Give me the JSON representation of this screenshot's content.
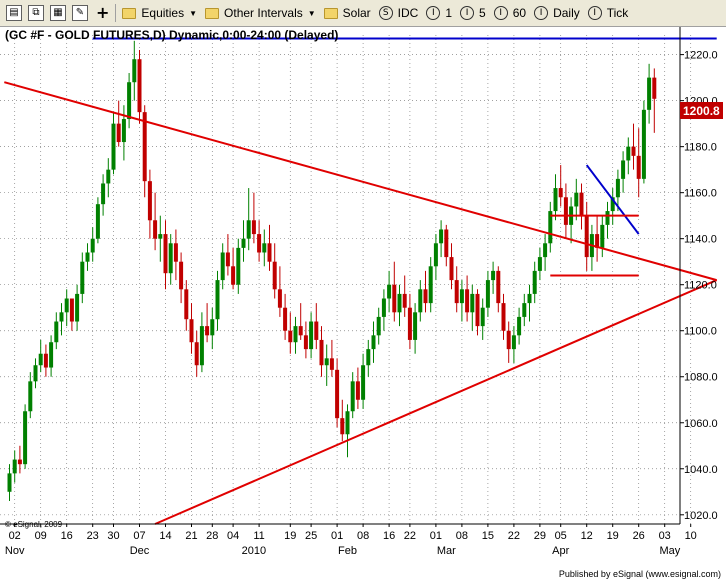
{
  "toolbar": {
    "icons": [
      "chart-icon",
      "copy-icon",
      "layout-icon",
      "edit-icon",
      "plus-icon"
    ],
    "equities_label": "Equities",
    "intervals_label": "Other Intervals",
    "solar_label": "Solar",
    "idc_label": "IDC",
    "interval_1": "1",
    "interval_5": "5",
    "interval_60": "60",
    "daily_label": "Daily",
    "tick_label": "Tick"
  },
  "chart": {
    "title": "(GC #F - GOLD FUTURES,D) Dynamic,0:00-24:00 (Delayed)",
    "copyright": "© eSignal, 2009",
    "published": "Published by eSignal (www.esignal.com)",
    "last_price": "1200.8"
  },
  "chart_data": {
    "type": "candlestick",
    "title": "(GC #F - GOLD FUTURES,D) Dynamic,0:00-24:00 (Delayed)",
    "ylim": [
      1016,
      1232
    ],
    "yticks": [
      1020.0,
      1040.0,
      1060.0,
      1080.0,
      1100.0,
      1120.0,
      1140.0,
      1160.0,
      1180.0,
      1200.0,
      1220.0
    ],
    "xticks": [
      {
        "label": "02",
        "i": 1
      },
      {
        "label": "09",
        "i": 6
      },
      {
        "label": "16",
        "i": 11
      },
      {
        "label": "23",
        "i": 16
      },
      {
        "label": "30",
        "i": 20
      },
      {
        "label": "07",
        "i": 25
      },
      {
        "label": "14",
        "i": 30
      },
      {
        "label": "21",
        "i": 35
      },
      {
        "label": "28",
        "i": 39
      },
      {
        "label": "04",
        "i": 43
      },
      {
        "label": "11",
        "i": 48
      },
      {
        "label": "19",
        "i": 54
      },
      {
        "label": "25",
        "i": 58
      },
      {
        "label": "01",
        "i": 63
      },
      {
        "label": "08",
        "i": 68
      },
      {
        "label": "16",
        "i": 73
      },
      {
        "label": "22",
        "i": 77
      },
      {
        "label": "01",
        "i": 82
      },
      {
        "label": "08",
        "i": 87
      },
      {
        "label": "15",
        "i": 92
      },
      {
        "label": "22",
        "i": 97
      },
      {
        "label": "29",
        "i": 102
      },
      {
        "label": "05",
        "i": 106
      },
      {
        "label": "12",
        "i": 111
      },
      {
        "label": "19",
        "i": 116
      },
      {
        "label": "26",
        "i": 121
      },
      {
        "label": "03",
        "i": 126
      },
      {
        "label": "10",
        "i": 131
      }
    ],
    "months": [
      {
        "label": "Nov",
        "i": 1
      },
      {
        "label": "Dec",
        "i": 25
      },
      {
        "label": "2010",
        "i": 47
      },
      {
        "label": "Feb",
        "i": 65
      },
      {
        "label": "Mar",
        "i": 84
      },
      {
        "label": "Apr",
        "i": 106
      },
      {
        "label": "May",
        "i": 127
      }
    ],
    "candles": [
      [
        1030,
        1042,
        1026,
        1038
      ],
      [
        1038,
        1048,
        1034,
        1044
      ],
      [
        1044,
        1050,
        1038,
        1042
      ],
      [
        1042,
        1068,
        1040,
        1065
      ],
      [
        1065,
        1082,
        1062,
        1078
      ],
      [
        1078,
        1088,
        1075,
        1085
      ],
      [
        1085,
        1096,
        1082,
        1090
      ],
      [
        1090,
        1094,
        1080,
        1084
      ],
      [
        1084,
        1098,
        1080,
        1095
      ],
      [
        1095,
        1108,
        1092,
        1104
      ],
      [
        1104,
        1112,
        1098,
        1108
      ],
      [
        1108,
        1118,
        1102,
        1114
      ],
      [
        1114,
        1110,
        1100,
        1104
      ],
      [
        1104,
        1120,
        1100,
        1116
      ],
      [
        1116,
        1134,
        1112,
        1130
      ],
      [
        1130,
        1138,
        1126,
        1134
      ],
      [
        1134,
        1145,
        1130,
        1140
      ],
      [
        1140,
        1158,
        1138,
        1155
      ],
      [
        1155,
        1168,
        1150,
        1164
      ],
      [
        1164,
        1175,
        1158,
        1170
      ],
      [
        1170,
        1195,
        1168,
        1190
      ],
      [
        1190,
        1200,
        1180,
        1182
      ],
      [
        1182,
        1198,
        1174,
        1192
      ],
      [
        1192,
        1212,
        1188,
        1208
      ],
      [
        1208,
        1226,
        1200,
        1218
      ],
      [
        1218,
        1222,
        1190,
        1195
      ],
      [
        1195,
        1198,
        1158,
        1165
      ],
      [
        1165,
        1170,
        1140,
        1148
      ],
      [
        1148,
        1160,
        1135,
        1140
      ],
      [
        1140,
        1150,
        1130,
        1142
      ],
      [
        1142,
        1148,
        1118,
        1125
      ],
      [
        1125,
        1142,
        1120,
        1138
      ],
      [
        1138,
        1144,
        1122,
        1130
      ],
      [
        1130,
        1134,
        1112,
        1118
      ],
      [
        1118,
        1122,
        1100,
        1105
      ],
      [
        1105,
        1112,
        1090,
        1095
      ],
      [
        1095,
        1100,
        1080,
        1085
      ],
      [
        1085,
        1108,
        1082,
        1102
      ],
      [
        1102,
        1112,
        1095,
        1098
      ],
      [
        1098,
        1110,
        1092,
        1105
      ],
      [
        1105,
        1126,
        1100,
        1122
      ],
      [
        1122,
        1138,
        1118,
        1134
      ],
      [
        1134,
        1142,
        1124,
        1128
      ],
      [
        1128,
        1136,
        1118,
        1120
      ],
      [
        1120,
        1140,
        1116,
        1136
      ],
      [
        1136,
        1148,
        1130,
        1140
      ],
      [
        1140,
        1162,
        1135,
        1148
      ],
      [
        1148,
        1160,
        1138,
        1142
      ],
      [
        1142,
        1148,
        1130,
        1134
      ],
      [
        1134,
        1144,
        1128,
        1138
      ],
      [
        1138,
        1146,
        1126,
        1130
      ],
      [
        1130,
        1138,
        1114,
        1118
      ],
      [
        1118,
        1128,
        1106,
        1110
      ],
      [
        1110,
        1116,
        1096,
        1100
      ],
      [
        1100,
        1108,
        1090,
        1095
      ],
      [
        1095,
        1106,
        1090,
        1102
      ],
      [
        1102,
        1112,
        1096,
        1098
      ],
      [
        1098,
        1104,
        1088,
        1092
      ],
      [
        1092,
        1108,
        1088,
        1104
      ],
      [
        1104,
        1112,
        1092,
        1096
      ],
      [
        1096,
        1102,
        1080,
        1085
      ],
      [
        1085,
        1094,
        1076,
        1088
      ],
      [
        1088,
        1096,
        1080,
        1083
      ],
      [
        1083,
        1088,
        1058,
        1062
      ],
      [
        1062,
        1070,
        1052,
        1055
      ],
      [
        1055,
        1068,
        1045,
        1065
      ],
      [
        1065,
        1082,
        1062,
        1078
      ],
      [
        1078,
        1084,
        1066,
        1070
      ],
      [
        1070,
        1090,
        1066,
        1085
      ],
      [
        1085,
        1096,
        1080,
        1092
      ],
      [
        1092,
        1104,
        1086,
        1098
      ],
      [
        1098,
        1110,
        1094,
        1106
      ],
      [
        1106,
        1118,
        1100,
        1114
      ],
      [
        1114,
        1126,
        1108,
        1120
      ],
      [
        1120,
        1130,
        1104,
        1108
      ],
      [
        1108,
        1120,
        1102,
        1116
      ],
      [
        1116,
        1124,
        1106,
        1110
      ],
      [
        1110,
        1116,
        1092,
        1096
      ],
      [
        1096,
        1112,
        1090,
        1108
      ],
      [
        1108,
        1122,
        1104,
        1118
      ],
      [
        1118,
        1126,
        1108,
        1112
      ],
      [
        1112,
        1132,
        1108,
        1128
      ],
      [
        1128,
        1142,
        1122,
        1138
      ],
      [
        1138,
        1148,
        1132,
        1144
      ],
      [
        1144,
        1146,
        1128,
        1132
      ],
      [
        1132,
        1138,
        1118,
        1122
      ],
      [
        1122,
        1128,
        1108,
        1112
      ],
      [
        1112,
        1122,
        1104,
        1118
      ],
      [
        1118,
        1124,
        1104,
        1108
      ],
      [
        1108,
        1120,
        1100,
        1116
      ],
      [
        1116,
        1118,
        1098,
        1102
      ],
      [
        1102,
        1114,
        1096,
        1110
      ],
      [
        1110,
        1126,
        1106,
        1122
      ],
      [
        1122,
        1130,
        1116,
        1126
      ],
      [
        1126,
        1128,
        1108,
        1112
      ],
      [
        1112,
        1116,
        1096,
        1100
      ],
      [
        1100,
        1104,
        1086,
        1092
      ],
      [
        1092,
        1102,
        1086,
        1098
      ],
      [
        1098,
        1110,
        1094,
        1106
      ],
      [
        1106,
        1116,
        1102,
        1112
      ],
      [
        1112,
        1120,
        1104,
        1116
      ],
      [
        1116,
        1130,
        1112,
        1126
      ],
      [
        1126,
        1136,
        1122,
        1132
      ],
      [
        1132,
        1142,
        1126,
        1138
      ],
      [
        1138,
        1156,
        1134,
        1152
      ],
      [
        1152,
        1168,
        1148,
        1162
      ],
      [
        1162,
        1172,
        1154,
        1158
      ],
      [
        1158,
        1164,
        1140,
        1146
      ],
      [
        1146,
        1158,
        1138,
        1154
      ],
      [
        1154,
        1166,
        1148,
        1160
      ],
      [
        1160,
        1164,
        1144,
        1150
      ],
      [
        1150,
        1156,
        1126,
        1132
      ],
      [
        1132,
        1146,
        1126,
        1142
      ],
      [
        1142,
        1150,
        1130,
        1136
      ],
      [
        1136,
        1150,
        1132,
        1146
      ],
      [
        1146,
        1156,
        1140,
        1152
      ],
      [
        1152,
        1162,
        1146,
        1158
      ],
      [
        1158,
        1170,
        1152,
        1166
      ],
      [
        1166,
        1178,
        1160,
        1174
      ],
      [
        1174,
        1184,
        1168,
        1180
      ],
      [
        1180,
        1190,
        1170,
        1176
      ],
      [
        1176,
        1188,
        1158,
        1166
      ],
      [
        1166,
        1200,
        1164,
        1196
      ],
      [
        1196,
        1216,
        1190,
        1210
      ],
      [
        1210,
        1214,
        1186,
        1200.8
      ]
    ],
    "trendlines": [
      {
        "color": "#e00000",
        "from": [
          -1,
          1208
        ],
        "to": [
          136,
          1122
        ]
      },
      {
        "color": "#e00000",
        "from": [
          28,
          1016
        ],
        "to": [
          136,
          1122
        ]
      },
      {
        "color": "#0000cc",
        "from": [
          16,
          1227
        ],
        "to": [
          136,
          1227
        ]
      },
      {
        "color": "#0000cc",
        "from": [
          111,
          1172
        ],
        "to": [
          121,
          1142
        ]
      },
      {
        "color": "#e00000",
        "from": [
          104,
          1150
        ],
        "to": [
          121,
          1150
        ]
      },
      {
        "color": "#e00000",
        "from": [
          104,
          1124
        ],
        "to": [
          121,
          1124
        ]
      }
    ]
  }
}
